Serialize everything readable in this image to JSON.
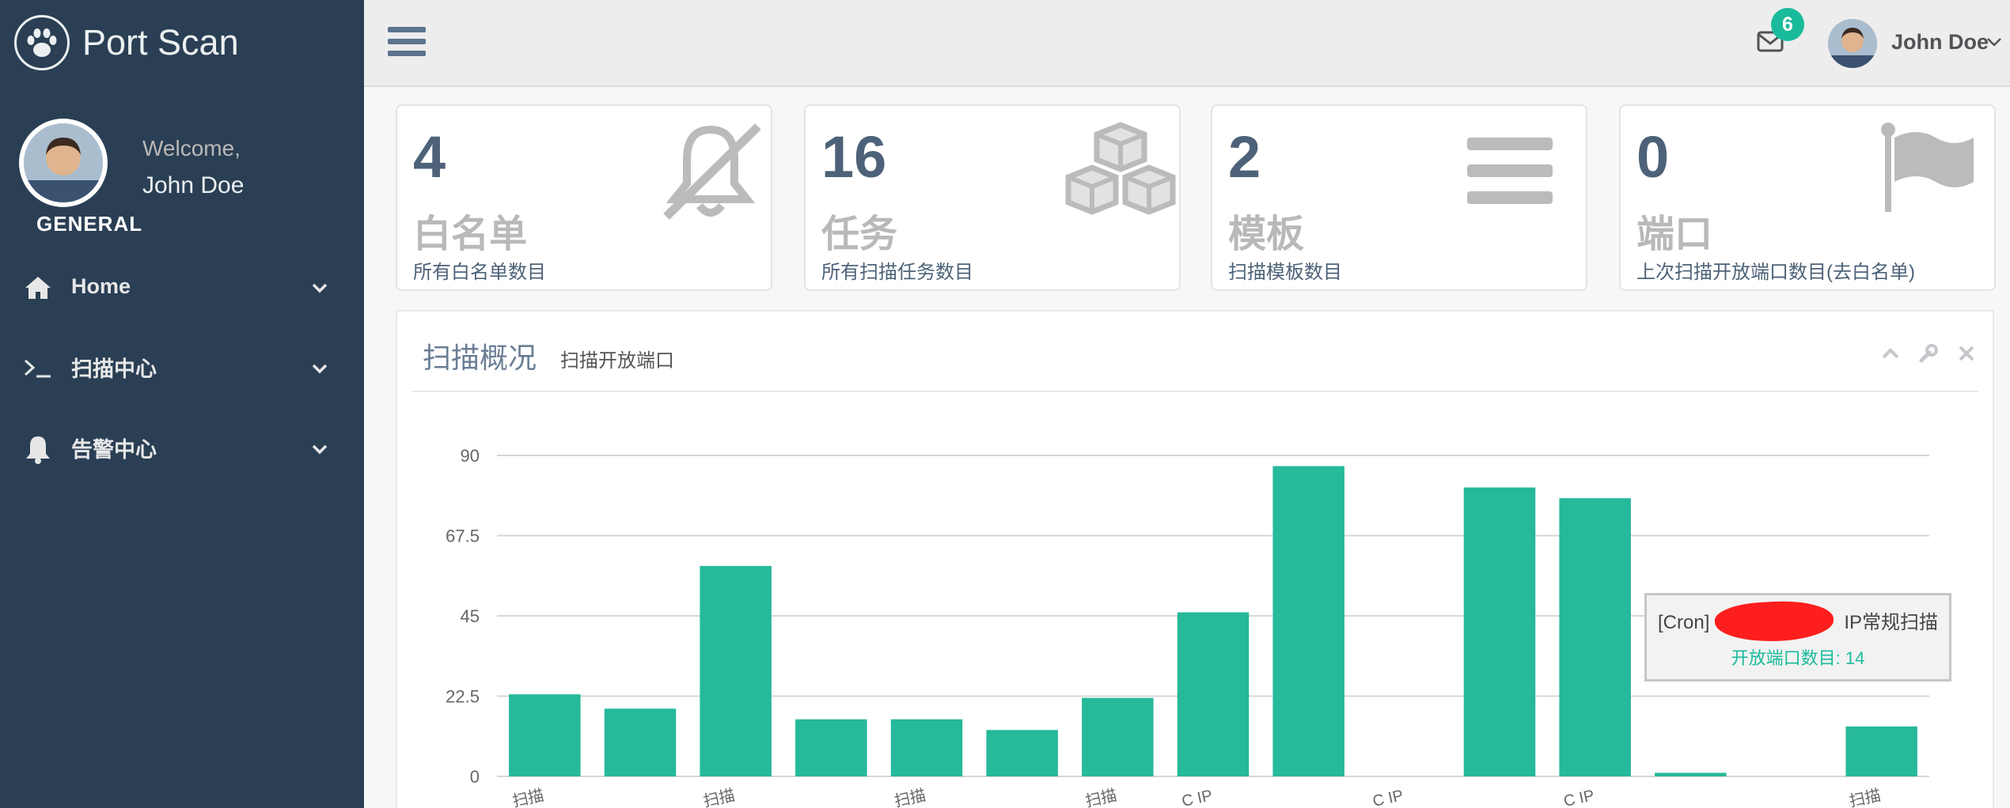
{
  "app": {
    "title": "Port Scan"
  },
  "sidebar": {
    "welcome": "Welcome,",
    "username": "John Doe",
    "section": "GENERAL",
    "items": [
      {
        "label": "Home",
        "icon": "home-icon"
      },
      {
        "label": "扫描中心",
        "icon": "terminal-icon"
      },
      {
        "label": "告警中心",
        "icon": "bell-icon"
      }
    ]
  },
  "topnav": {
    "badge_count": "6",
    "user": "John Doe"
  },
  "tiles": [
    {
      "count": "4",
      "label": "白名单",
      "desc": "所有白名单数目",
      "icon": "bell-slash-icon"
    },
    {
      "count": "16",
      "label": "任务",
      "desc": "所有扫描任务数目",
      "icon": "cubes-icon"
    },
    {
      "count": "2",
      "label": "模板",
      "desc": "扫描模板数目",
      "icon": "bars-icon"
    },
    {
      "count": "0",
      "label": "端口",
      "desc": "上次扫描开放端口数目(去白名单)",
      "icon": "flag-icon"
    }
  ],
  "panel": {
    "title": "扫描概况",
    "subtitle": "扫描开放端口"
  },
  "tooltip": {
    "title_prefix": "[Cron]",
    "title_suffix": "IP常规扫描",
    "value": "开放端口数目: 14"
  },
  "chart_data": {
    "type": "bar",
    "color": "#26B99A",
    "yticks": [
      0,
      22.5,
      45,
      67.5,
      90
    ],
    "ylim": [
      0,
      90
    ],
    "values": [
      23,
      19,
      59,
      16,
      16,
      13,
      22,
      46,
      87,
      0,
      81,
      78,
      1,
      0,
      14
    ],
    "xtick_labels": [
      "扫描",
      "",
      "扫描",
      "",
      "扫描",
      "",
      "扫描",
      "C IP",
      "",
      "C IP",
      "",
      "C IP",
      "",
      "",
      "扫描"
    ],
    "grid": true
  }
}
